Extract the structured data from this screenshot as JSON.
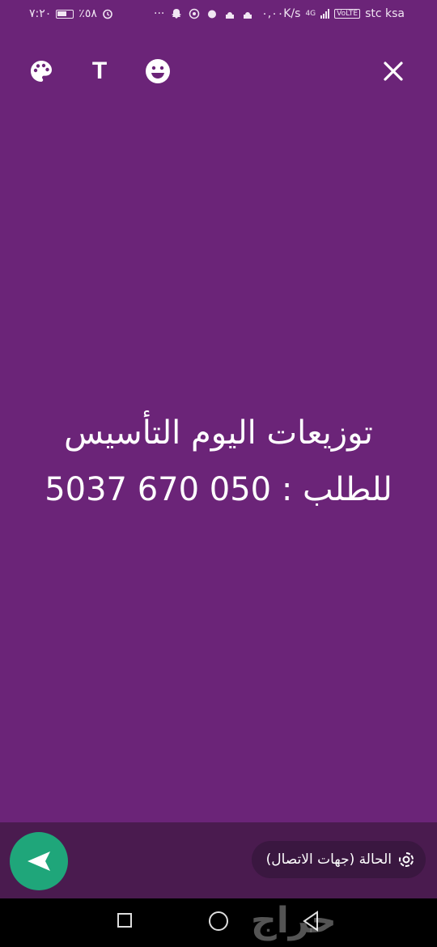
{
  "status_bar": {
    "time": "٧:٢٠",
    "battery": "٪٥٨",
    "network_speed": "٠,٠٠K/s",
    "network_type": "4G",
    "volte": "VoLTE",
    "carrier": "stc ksa",
    "more": "···"
  },
  "toolbar": {
    "palette_icon": "palette-icon",
    "text_label": "T",
    "emoji_icon": "smiley-icon",
    "close_icon": "close-icon"
  },
  "status_text": {
    "line1": "توزيعات اليوم التأسيس",
    "line2": "للطلب : 050 670 5037"
  },
  "composer": {
    "audience_label": "الحالة (جهات الاتصال)",
    "send_icon": "send-icon"
  },
  "watermark": "حراج",
  "colors": {
    "background": "#6b2478",
    "bottom_bar": "#4a1b4f",
    "send_button": "#1fa67a"
  }
}
